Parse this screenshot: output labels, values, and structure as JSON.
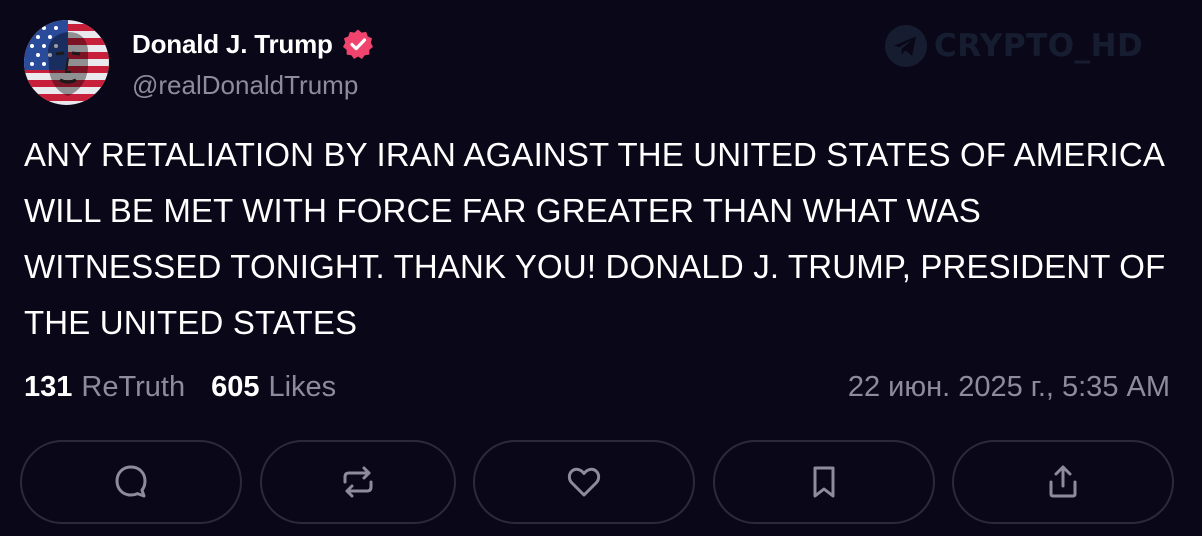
{
  "post": {
    "display_name": "Donald J. Trump",
    "handle": "@realDonaldTrump",
    "verified": true,
    "text": "ANY RETALIATION BY IRAN AGAINST THE UNITED STATES OF AMERICA WILL BE MET WITH FORCE FAR GREATER THAN WHAT WAS WITNESSED TONIGHT. THANK YOU! DONALD J. TRUMP, PRESIDENT OF THE UNITED STATES",
    "retruths_count": "131",
    "retruths_label": "ReTruth",
    "likes_count": "605",
    "likes_label": "Likes",
    "timestamp": "22 июн. 2025 г., 5:35 AM"
  },
  "watermark": {
    "text": "CRYPTO_HD",
    "icon": "telegram-icon"
  },
  "actions": [
    {
      "name": "reply",
      "icon": "comment-icon"
    },
    {
      "name": "retruth",
      "icon": "repost-icon"
    },
    {
      "name": "like",
      "icon": "heart-icon"
    },
    {
      "name": "bookmark",
      "icon": "bookmark-icon"
    },
    {
      "name": "share",
      "icon": "share-icon"
    }
  ],
  "colors": {
    "background": "#0a0818",
    "text": "#ffffff",
    "muted_text": "#8e8b9d",
    "verified_badge": "#f0436e",
    "button_border": "#2c2a3a"
  }
}
